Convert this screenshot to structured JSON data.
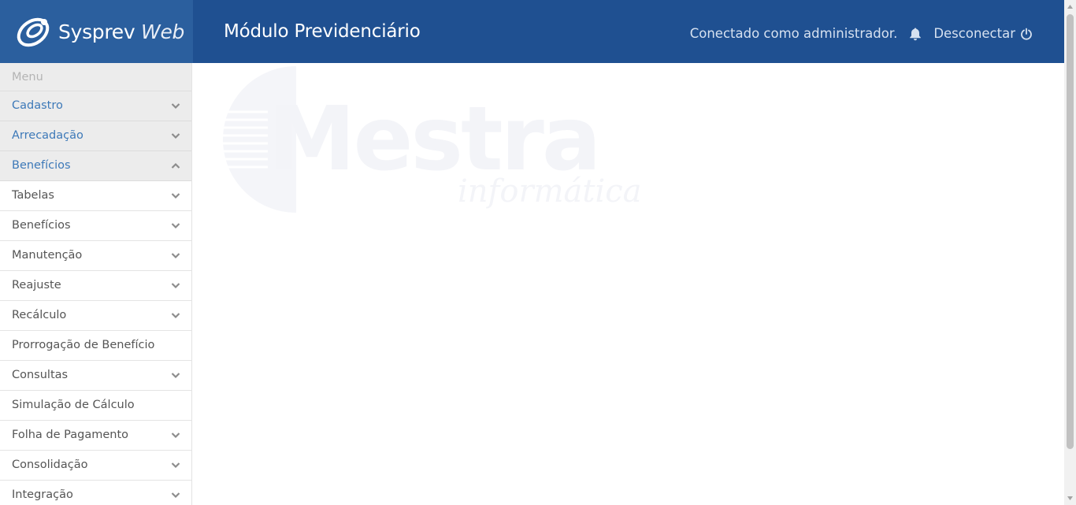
{
  "header": {
    "brand_name": "Sysprev",
    "brand_suffix": "Web",
    "module_title": "Módulo Previdenciário",
    "connected_text": "Conectado como administrador.",
    "logout_label": "Desconectar",
    "colors": {
      "header_bg": "#1f5091",
      "brand_bg": "#2b5f9e"
    }
  },
  "sidebar": {
    "caption": "Menu",
    "groups": [
      {
        "label": "Cadastro",
        "expanded": false
      },
      {
        "label": "Arrecadação",
        "expanded": false
      },
      {
        "label": "Benefícios",
        "expanded": true
      }
    ],
    "sub_items": [
      {
        "label": "Tabelas",
        "has_children": true
      },
      {
        "label": "Benefícios",
        "has_children": true
      },
      {
        "label": "Manutenção",
        "has_children": true
      },
      {
        "label": "Reajuste",
        "has_children": true
      },
      {
        "label": "Recálculo",
        "has_children": true
      },
      {
        "label": "Prorrogação de Benefício",
        "has_children": false
      },
      {
        "label": "Consultas",
        "has_children": true
      },
      {
        "label": "Simulação de Cálculo",
        "has_children": false
      },
      {
        "label": "Folha de Pagamento",
        "has_children": true
      },
      {
        "label": "Consolidação",
        "has_children": true
      },
      {
        "label": "Integração",
        "has_children": true
      }
    ]
  },
  "content": {
    "watermark_title": "Mestra",
    "watermark_subtitle": "informática"
  }
}
